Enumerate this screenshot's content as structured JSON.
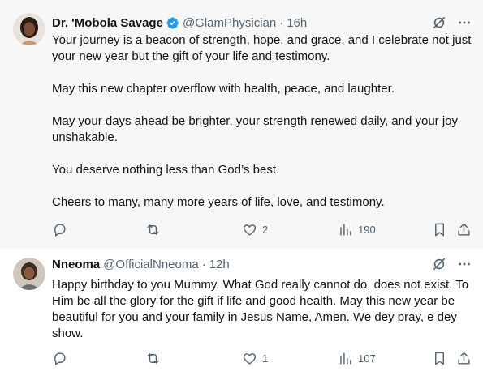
{
  "tweets": [
    {
      "author_name": "Dr. 'Mobola Savage",
      "verified": true,
      "handle": "@GlamPhysician",
      "separator": "·",
      "time": "16h",
      "paragraphs": [
        "Your journey is a beacon of strength, hope, and grace, and I celebrate not just your new year but the gift of your life and testimony.",
        "May this new chapter overflow with health, peace, and laughter.",
        "May your days ahead be brighter, your strength renewed daily, and your joy unshakable.",
        "You deserve nothing less than God’s best.",
        "Cheers to many, many more years of life, love, and testimony."
      ],
      "reply_count": "",
      "repost_count": "",
      "like_count": "2",
      "view_count": "190"
    },
    {
      "author_name": "Nneoma",
      "verified": false,
      "handle": "@OfficialNneoma",
      "separator": "·",
      "time": "12h",
      "paragraphs": [
        "Happy birthday to you Mummy. What God really cannot do, does not exist. To Him be all the glory for the gift if life and good health. May this new year be beautiful for you and your family in Jesus Name, Amen. We dey pray, e dey show."
      ],
      "reply_count": "",
      "repost_count": "",
      "like_count": "1",
      "view_count": "107"
    }
  ],
  "colors": {
    "verified_blue": "#1d9bf0",
    "secondary_text": "#536471",
    "primary_text": "#0f1419",
    "highlight_bg": "#f7f7f7"
  },
  "icons": {
    "grok": "grok-icon",
    "more": "more-icon",
    "reply": "reply-icon",
    "repost": "repost-icon",
    "like": "heart-icon",
    "views": "views-icon",
    "bookmark": "bookmark-icon",
    "share": "share-icon"
  }
}
